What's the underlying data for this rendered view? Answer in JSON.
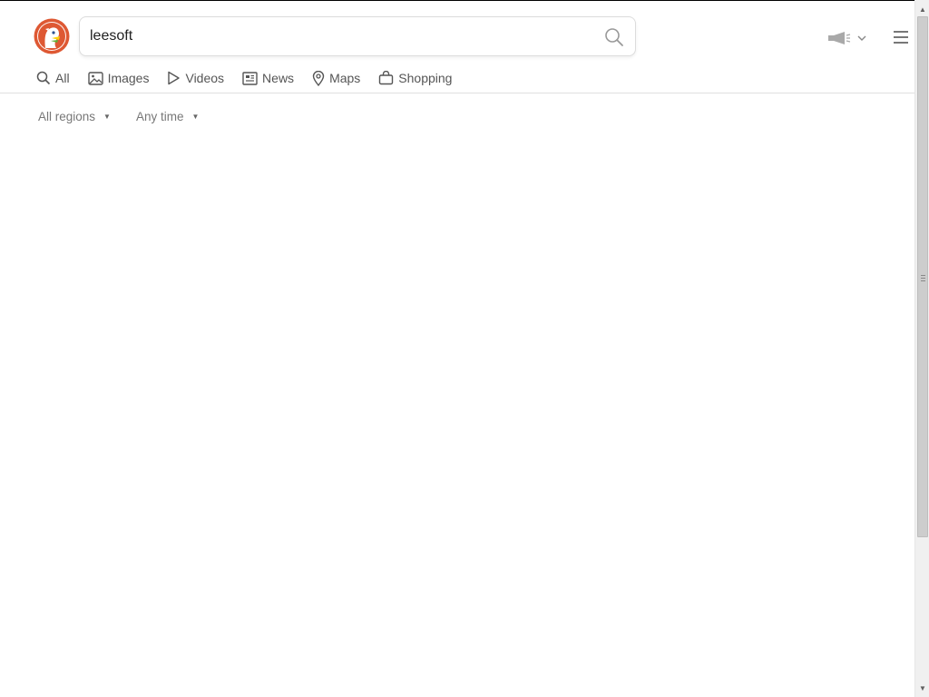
{
  "search": {
    "query": "leesoft"
  },
  "tabs": [
    {
      "label": "All",
      "icon": "search-icon"
    },
    {
      "label": "Images",
      "icon": "image-icon"
    },
    {
      "label": "Videos",
      "icon": "play-icon"
    },
    {
      "label": "News",
      "icon": "newspaper-icon"
    },
    {
      "label": "Maps",
      "icon": "map-pin-icon"
    },
    {
      "label": "Shopping",
      "icon": "shopping-bag-icon"
    }
  ],
  "filters": {
    "region": "All regions",
    "time": "Any time"
  },
  "colors": {
    "brand": "#de5833",
    "text": "#555555",
    "muted": "#777777"
  },
  "icons": {
    "logo": "duck-logo",
    "announce": "megaphone-icon",
    "menu": "hamburger-menu-icon"
  }
}
